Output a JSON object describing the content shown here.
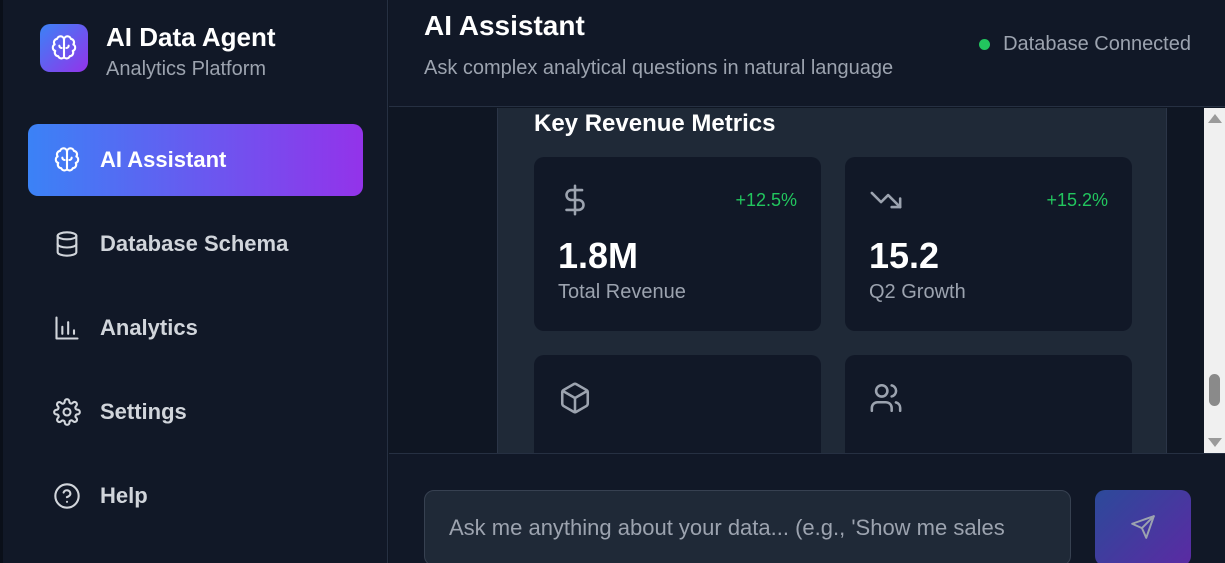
{
  "brand": {
    "title": "AI Data Agent",
    "subtitle": "Analytics Platform",
    "icon": "brain-icon"
  },
  "sidebar": {
    "items": [
      {
        "label": "AI Assistant",
        "icon": "brain-icon",
        "active": true
      },
      {
        "label": "Database Schema",
        "icon": "database-icon",
        "active": false
      },
      {
        "label": "Analytics",
        "icon": "bar-chart-icon",
        "active": false
      },
      {
        "label": "Settings",
        "icon": "gear-icon",
        "active": false
      },
      {
        "label": "Help",
        "icon": "help-circle-icon",
        "active": false
      }
    ]
  },
  "header": {
    "title": "AI Assistant",
    "subtitle": "Ask complex analytical questions in natural language",
    "status": {
      "text": "Database Connected",
      "color": "#22c55e"
    }
  },
  "metrics": {
    "title": "Key Revenue Metrics",
    "cards": [
      {
        "icon": "dollar-icon",
        "change": "+12.5%",
        "value": "1.8M",
        "label": "Total Revenue"
      },
      {
        "icon": "trending-down-icon",
        "change": "+15.2%",
        "value": "15.2",
        "label": "Q2 Growth"
      },
      {
        "icon": "package-icon",
        "change": "",
        "value": "",
        "label": ""
      },
      {
        "icon": "users-icon",
        "change": "",
        "value": "",
        "label": ""
      }
    ]
  },
  "composer": {
    "placeholder": "Ask me anything about your data... (e.g., 'Show me sales",
    "send_icon": "send-icon"
  },
  "colors": {
    "accent_start": "#3b82f6",
    "accent_end": "#9333ea",
    "positive": "#22c55e"
  }
}
